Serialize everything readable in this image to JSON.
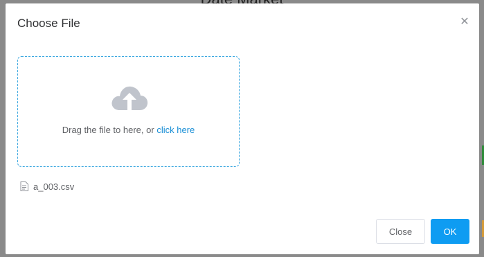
{
  "background": {
    "title": "Date Market"
  },
  "dialog": {
    "title": "Choose File",
    "close_icon": "close-icon"
  },
  "upload": {
    "icon": "cloud-upload-icon",
    "prompt": "Drag the file to here, or",
    "link": "click here"
  },
  "file": {
    "icon": "document-icon",
    "name": "a_003.csv"
  },
  "buttons": {
    "close": "Close",
    "ok": "OK"
  },
  "colors": {
    "accent": "#0e9cf2",
    "link": "#1a8fd6",
    "dropzone_border": "#3aa7e0",
    "cloud": "#c0c4cc"
  }
}
